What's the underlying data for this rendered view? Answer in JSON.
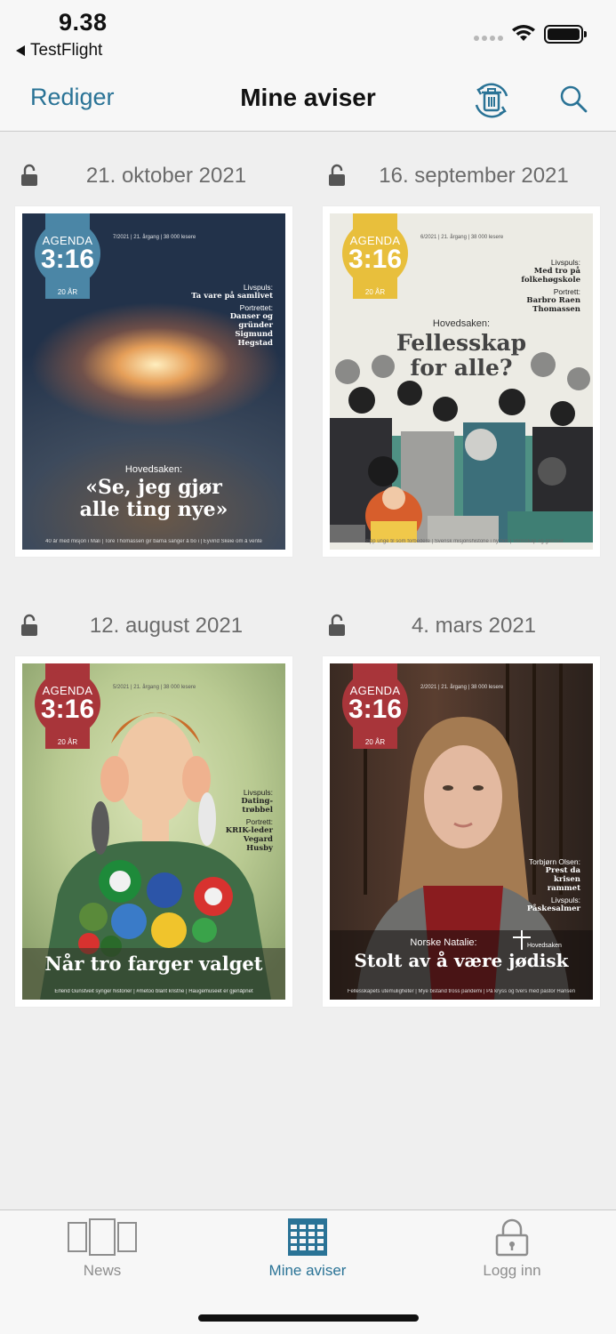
{
  "status": {
    "time": "9.38",
    "back_app": "TestFlight"
  },
  "nav": {
    "edit_label": "Rediger",
    "title": "Mine aviser"
  },
  "issues": [
    {
      "date": "21. oktober 2021",
      "cover": {
        "brand": "AGENDA",
        "number": "3:16",
        "years": "20 ÅR",
        "masthead": "7/2021  |  21. årgang  |  38 000 lesere",
        "side1_label": "Livspuls:",
        "side1_value": "Ta vare på samlivet",
        "side2_label": "Portrettet:",
        "side2_value": "Danser og gründer Sigmund Hegstad",
        "kicker": "Hovedsaken:",
        "headline": "«Se, jeg gjør alle ting nye»",
        "footer": "40 år med misjon i Mali  |  Tore Thomassen gir barna sanger å bo i  |  Eyvind Skeie om å vente"
      }
    },
    {
      "date": "16. september 2021",
      "cover": {
        "brand": "AGENDA",
        "number": "3:16",
        "years": "20 ÅR",
        "masthead": "6/2021  |  21. årgang  |  38 000 lesere",
        "side1_label": "Livspuls:",
        "side1_value": "Med tro på folkehøgskole",
        "side2_label": "Portrett:",
        "side2_value": "Barbro Raen Thomassen",
        "kicker": "Hovedsaken:",
        "headline": "Fellesskap for alle?",
        "footer": "– Slipp unge til som forbedere  |  Svensk misjonshistorie i ny bok  |  Vennskap og grenser"
      }
    },
    {
      "date": "12. august 2021",
      "cover": {
        "brand": "AGENDA",
        "number": "3:16",
        "years": "20 ÅR",
        "masthead": "5/2021  |  21. årgang  |  38 000 lesere",
        "side1_label": "Livspuls:",
        "side1_value": "Dating-trøbbel",
        "side2_label": "Portrett:",
        "side2_value": "KRIK-leder Vegard Husby",
        "headline": "Når tro farger valget",
        "footer": "Erlend Gunstveit synger historier  |  #metoo blant kristne  |  Haugemuseet er gjenåpnet"
      }
    },
    {
      "date": "4. mars 2021",
      "cover": {
        "brand": "AGENDA",
        "number": "3:16",
        "years": "20 ÅR",
        "masthead": "2/2021  |  21. årgang  |  38 000 lesere",
        "side1_label": "Torbjørn Olsen:",
        "side1_value": "Prest da krisen rammet",
        "side2_label": "Livspuls:",
        "side2_value": "Påskesalmer",
        "kicker": "Norske Natalie:",
        "hovedsaken": "Hovedsaken",
        "headline": "Stolt av å være jødisk",
        "footer": "Fellesskapets utemuligheter  |  Mye bistand tross pandemi  |  På kryss og tvers med pastor Hansen"
      }
    }
  ],
  "tabs": [
    {
      "label": "News"
    },
    {
      "label": "Mine aviser"
    },
    {
      "label": "Logg inn"
    }
  ],
  "colors": {
    "accent": "#2a7396",
    "badge_blue": "#4b86a6",
    "badge_gold": "#e8bf3c",
    "badge_red": "#a8353a"
  }
}
